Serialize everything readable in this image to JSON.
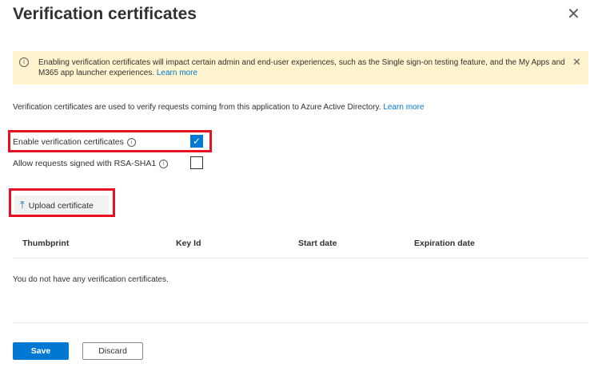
{
  "panel": {
    "title": "Verification certificates",
    "close_icon": "close-icon"
  },
  "banner": {
    "message": "Enabling verification certificates will impact certain admin and end-user experiences, such as the Single sign-on testing feature, and the My Apps and M365 app launcher experiences.",
    "link": "Learn more",
    "info_icon": "info-icon",
    "dismiss_icon": "close-icon",
    "background": "#fff4ce"
  },
  "description": {
    "text": "Verification certificates are used to verify requests coming from this application to Azure Active Directory.",
    "link": "Learn more"
  },
  "options": {
    "enable_label": "Enable verification certificates",
    "enable_checked": true,
    "rsa_label": "Allow requests signed with RSA-SHA1",
    "rsa_checked": false
  },
  "toolbar": {
    "upload_label": "Upload certificate",
    "upload_icon": "upload-arrow-icon"
  },
  "table": {
    "columns": [
      "Thumbprint",
      "Key Id",
      "Start date",
      "Expiration date"
    ],
    "empty_message": "You do not have any verification certificates."
  },
  "footer": {
    "save_label": "Save",
    "discard_label": "Discard"
  },
  "colors": {
    "accent": "#0078d4",
    "highlight": "#e81123"
  }
}
